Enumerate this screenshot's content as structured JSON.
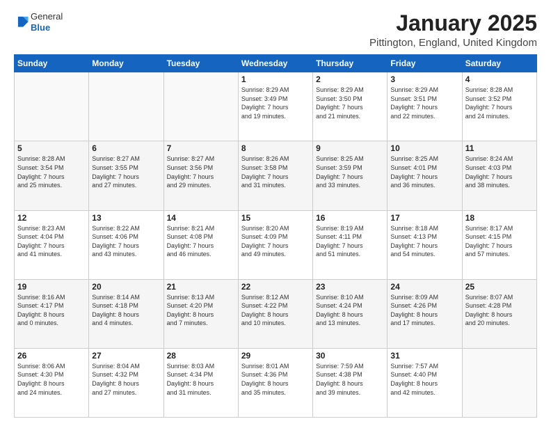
{
  "logo": {
    "line1": "General",
    "line2": "Blue"
  },
  "title": "January 2025",
  "subtitle": "Pittington, England, United Kingdom",
  "weekdays": [
    "Sunday",
    "Monday",
    "Tuesday",
    "Wednesday",
    "Thursday",
    "Friday",
    "Saturday"
  ],
  "weeks": [
    [
      {
        "day": "",
        "info": ""
      },
      {
        "day": "",
        "info": ""
      },
      {
        "day": "",
        "info": ""
      },
      {
        "day": "1",
        "info": "Sunrise: 8:29 AM\nSunset: 3:49 PM\nDaylight: 7 hours\nand 19 minutes."
      },
      {
        "day": "2",
        "info": "Sunrise: 8:29 AM\nSunset: 3:50 PM\nDaylight: 7 hours\nand 21 minutes."
      },
      {
        "day": "3",
        "info": "Sunrise: 8:29 AM\nSunset: 3:51 PM\nDaylight: 7 hours\nand 22 minutes."
      },
      {
        "day": "4",
        "info": "Sunrise: 8:28 AM\nSunset: 3:52 PM\nDaylight: 7 hours\nand 24 minutes."
      }
    ],
    [
      {
        "day": "5",
        "info": "Sunrise: 8:28 AM\nSunset: 3:54 PM\nDaylight: 7 hours\nand 25 minutes."
      },
      {
        "day": "6",
        "info": "Sunrise: 8:27 AM\nSunset: 3:55 PM\nDaylight: 7 hours\nand 27 minutes."
      },
      {
        "day": "7",
        "info": "Sunrise: 8:27 AM\nSunset: 3:56 PM\nDaylight: 7 hours\nand 29 minutes."
      },
      {
        "day": "8",
        "info": "Sunrise: 8:26 AM\nSunset: 3:58 PM\nDaylight: 7 hours\nand 31 minutes."
      },
      {
        "day": "9",
        "info": "Sunrise: 8:25 AM\nSunset: 3:59 PM\nDaylight: 7 hours\nand 33 minutes."
      },
      {
        "day": "10",
        "info": "Sunrise: 8:25 AM\nSunset: 4:01 PM\nDaylight: 7 hours\nand 36 minutes."
      },
      {
        "day": "11",
        "info": "Sunrise: 8:24 AM\nSunset: 4:03 PM\nDaylight: 7 hours\nand 38 minutes."
      }
    ],
    [
      {
        "day": "12",
        "info": "Sunrise: 8:23 AM\nSunset: 4:04 PM\nDaylight: 7 hours\nand 41 minutes."
      },
      {
        "day": "13",
        "info": "Sunrise: 8:22 AM\nSunset: 4:06 PM\nDaylight: 7 hours\nand 43 minutes."
      },
      {
        "day": "14",
        "info": "Sunrise: 8:21 AM\nSunset: 4:08 PM\nDaylight: 7 hours\nand 46 minutes."
      },
      {
        "day": "15",
        "info": "Sunrise: 8:20 AM\nSunset: 4:09 PM\nDaylight: 7 hours\nand 49 minutes."
      },
      {
        "day": "16",
        "info": "Sunrise: 8:19 AM\nSunset: 4:11 PM\nDaylight: 7 hours\nand 51 minutes."
      },
      {
        "day": "17",
        "info": "Sunrise: 8:18 AM\nSunset: 4:13 PM\nDaylight: 7 hours\nand 54 minutes."
      },
      {
        "day": "18",
        "info": "Sunrise: 8:17 AM\nSunset: 4:15 PM\nDaylight: 7 hours\nand 57 minutes."
      }
    ],
    [
      {
        "day": "19",
        "info": "Sunrise: 8:16 AM\nSunset: 4:17 PM\nDaylight: 8 hours\nand 0 minutes."
      },
      {
        "day": "20",
        "info": "Sunrise: 8:14 AM\nSunset: 4:18 PM\nDaylight: 8 hours\nand 4 minutes."
      },
      {
        "day": "21",
        "info": "Sunrise: 8:13 AM\nSunset: 4:20 PM\nDaylight: 8 hours\nand 7 minutes."
      },
      {
        "day": "22",
        "info": "Sunrise: 8:12 AM\nSunset: 4:22 PM\nDaylight: 8 hours\nand 10 minutes."
      },
      {
        "day": "23",
        "info": "Sunrise: 8:10 AM\nSunset: 4:24 PM\nDaylight: 8 hours\nand 13 minutes."
      },
      {
        "day": "24",
        "info": "Sunrise: 8:09 AM\nSunset: 4:26 PM\nDaylight: 8 hours\nand 17 minutes."
      },
      {
        "day": "25",
        "info": "Sunrise: 8:07 AM\nSunset: 4:28 PM\nDaylight: 8 hours\nand 20 minutes."
      }
    ],
    [
      {
        "day": "26",
        "info": "Sunrise: 8:06 AM\nSunset: 4:30 PM\nDaylight: 8 hours\nand 24 minutes."
      },
      {
        "day": "27",
        "info": "Sunrise: 8:04 AM\nSunset: 4:32 PM\nDaylight: 8 hours\nand 27 minutes."
      },
      {
        "day": "28",
        "info": "Sunrise: 8:03 AM\nSunset: 4:34 PM\nDaylight: 8 hours\nand 31 minutes."
      },
      {
        "day": "29",
        "info": "Sunrise: 8:01 AM\nSunset: 4:36 PM\nDaylight: 8 hours\nand 35 minutes."
      },
      {
        "day": "30",
        "info": "Sunrise: 7:59 AM\nSunset: 4:38 PM\nDaylight: 8 hours\nand 39 minutes."
      },
      {
        "day": "31",
        "info": "Sunrise: 7:57 AM\nSunset: 4:40 PM\nDaylight: 8 hours\nand 42 minutes."
      },
      {
        "day": "",
        "info": ""
      }
    ]
  ]
}
